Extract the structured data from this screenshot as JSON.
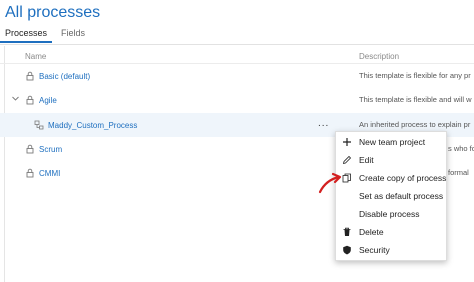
{
  "page": {
    "title": "All processes"
  },
  "tabs": [
    {
      "label": "Processes",
      "active": true
    },
    {
      "label": "Fields",
      "active": false
    }
  ],
  "columns": {
    "name": "Name",
    "description": "Description"
  },
  "rows": [
    {
      "name": "Basic (default)",
      "description": "This template is flexible for any pr",
      "icon": "lock-icon"
    },
    {
      "name": "Agile",
      "description": "This template is flexible and will w",
      "icon": "lock-icon",
      "expanded": true
    },
    {
      "name": "Maddy_Custom_Process",
      "description": "An inherited process to explain pr",
      "icon": "inherited-process-icon",
      "selected": true,
      "more": "..."
    },
    {
      "name": "Scrum",
      "description": "s who fo",
      "icon": "lock-icon"
    },
    {
      "name": "CMMI",
      "description": "formal",
      "icon": "lock-icon"
    }
  ],
  "context_menu": {
    "items": [
      {
        "label": "New team project",
        "icon": "plus-icon"
      },
      {
        "label": "Edit",
        "icon": "pencil-icon"
      },
      {
        "label": "Create copy of process",
        "icon": "copy-icon"
      },
      {
        "label": "Set as default process",
        "icon": ""
      },
      {
        "label": "Disable process",
        "icon": ""
      },
      {
        "label": "Delete",
        "icon": "trash-icon"
      },
      {
        "label": "Security",
        "icon": "shield-icon"
      }
    ]
  },
  "colors": {
    "accent": "#1e6fbf",
    "annotation": "#d32020",
    "selected_row": "#eff5fb"
  }
}
